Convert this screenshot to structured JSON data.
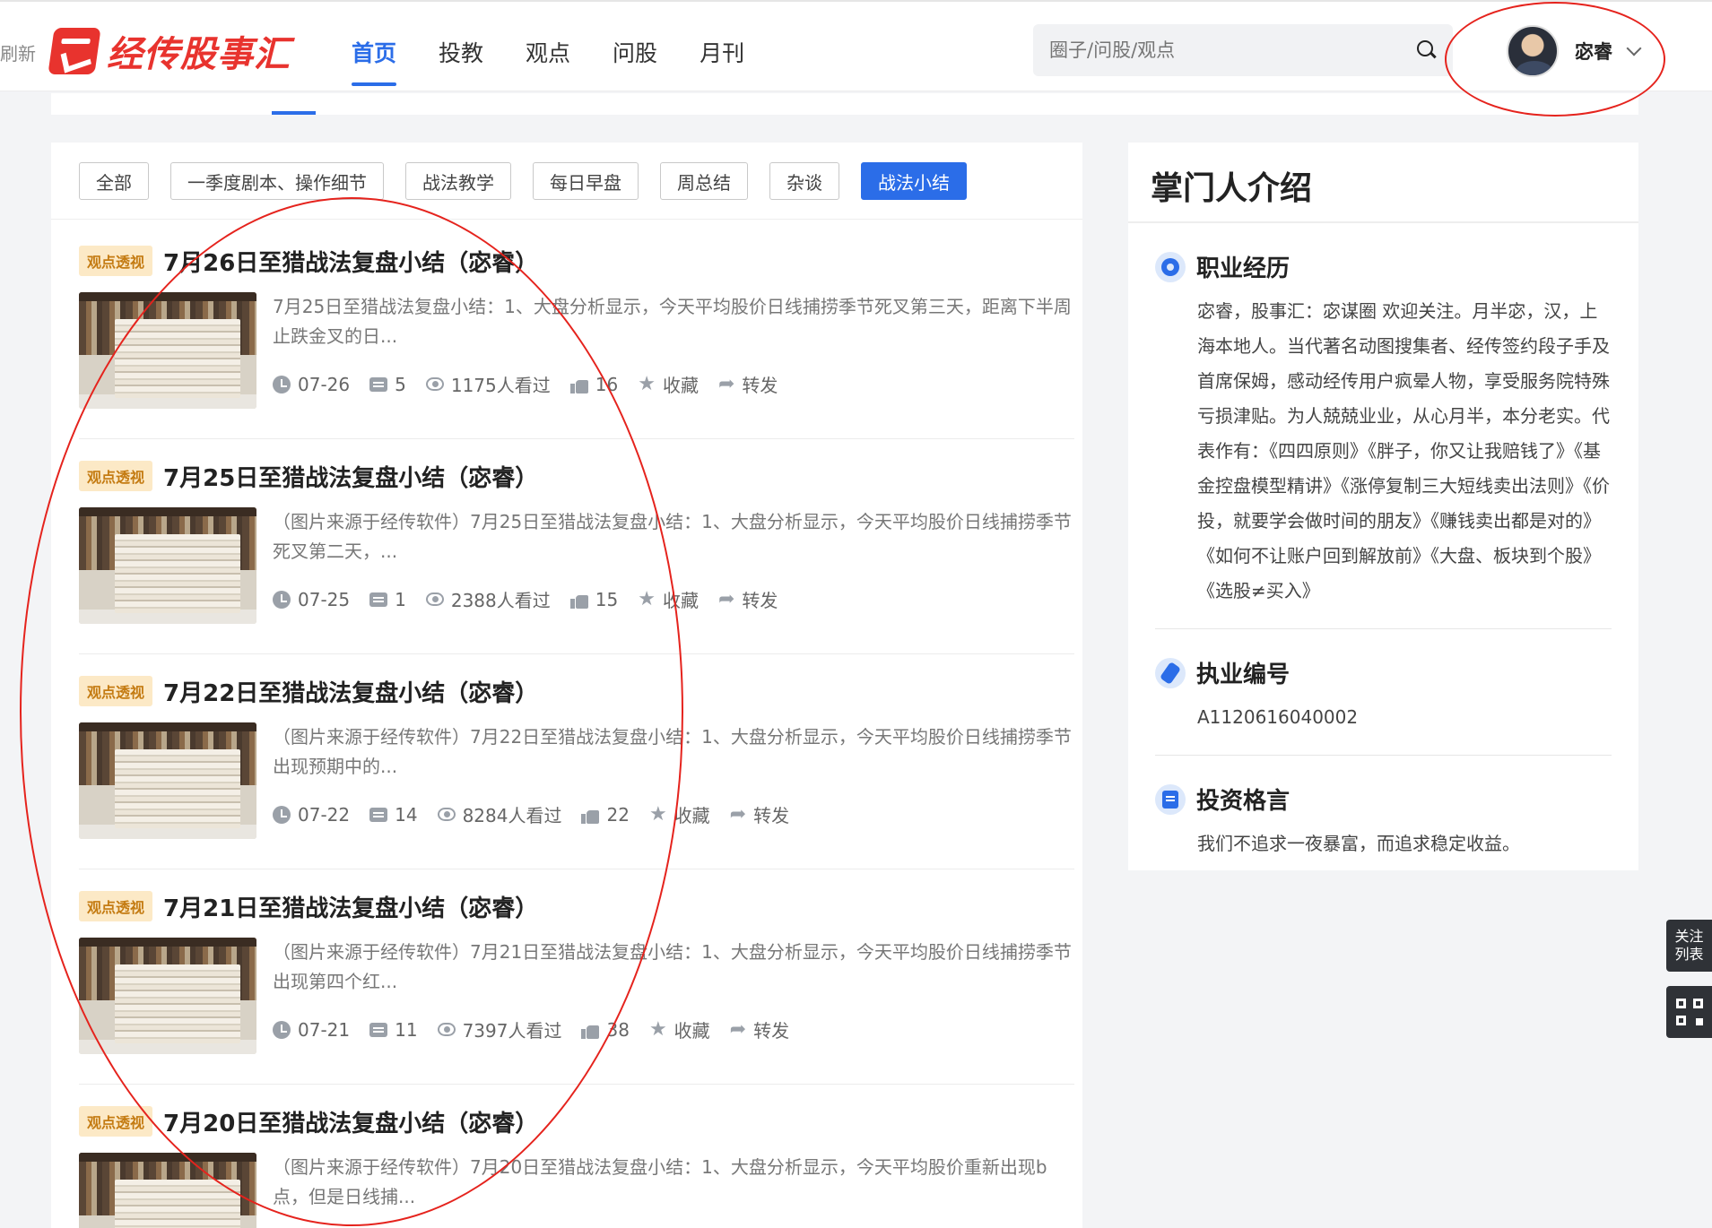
{
  "header": {
    "refresh_label": "刷新",
    "logo_text": "经传股事汇",
    "nav": [
      "首页",
      "投教",
      "观点",
      "问股",
      "月刊"
    ],
    "active_nav": "首页",
    "search_placeholder": "圈子/问股/观点",
    "user_name": "宓睿"
  },
  "filters": {
    "chips": [
      "全部",
      "一季度剧本、操作细节",
      "战法教学",
      "每日早盘",
      "周总结",
      "杂谈",
      "战法小结"
    ],
    "active": "战法小结"
  },
  "articles": [
    {
      "tag": "观点透视",
      "title": "7月26日至猎战法复盘小结（宓睿）",
      "summary": "7月25日至猎战法复盘小结：1、大盘分析显示，今天平均股价日线捕捞季节死叉第三天，距离下半周止跌金叉的日...",
      "date": "07-26",
      "comments": "5",
      "views": "1175人看过",
      "likes": "16",
      "favorite": "收藏",
      "share": "转发"
    },
    {
      "tag": "观点透视",
      "title": "7月25日至猎战法复盘小结（宓睿）",
      "summary": "（图片来源于经传软件）7月25日至猎战法复盘小结：1、大盘分析显示，今天平均股价日线捕捞季节死叉第二天，...",
      "date": "07-25",
      "comments": "1",
      "views": "2388人看过",
      "likes": "15",
      "favorite": "收藏",
      "share": "转发"
    },
    {
      "tag": "观点透视",
      "title": "7月22日至猎战法复盘小结（宓睿）",
      "summary": "（图片来源于经传软件）7月22日至猎战法复盘小结：1、大盘分析显示，今天平均股价日线捕捞季节出现预期中的...",
      "date": "07-22",
      "comments": "14",
      "views": "8284人看过",
      "likes": "22",
      "favorite": "收藏",
      "share": "转发"
    },
    {
      "tag": "观点透视",
      "title": "7月21日至猎战法复盘小结（宓睿）",
      "summary": "（图片来源于经传软件）7月21日至猎战法复盘小结：1、大盘分析显示，今天平均股价日线捕捞季节出现第四个红...",
      "date": "07-21",
      "comments": "11",
      "views": "7397人看过",
      "likes": "38",
      "favorite": "收藏",
      "share": "转发"
    },
    {
      "tag": "观点透视",
      "title": "7月20日至猎战法复盘小结（宓睿）",
      "summary": "（图片来源于经传软件）7月20日至猎战法复盘小结：1、大盘分析显示，今天平均股价重新出现b点，但是日线捕...",
      "date": "",
      "comments": "",
      "views": "",
      "likes": "",
      "favorite": "",
      "share": ""
    }
  ],
  "sidebar": {
    "title": "掌门人介绍",
    "career_title": "职业经历",
    "career_text": "宓睿，股事汇：宓谋圈 欢迎关注。月半宓，汉，上海本地人。当代著名动图搜集者、经传签约段子手及首席保姆，感动经传用户疯晕人物，享受服务院特殊亏损津贴。为人兢兢业业，从心月半，本分老实。代表作有：《四四原则》《胖子，你又让我赔钱了》《基金控盘模型精讲》《涨停复制三大短线卖出法则》《价投，就要学会做时间的朋友》《赚钱卖出都是对的》《如何不让账户回到解放前》《大盘、板块到个股》《选股≠买入》",
    "license_title": "执业编号",
    "license_no": "A1120616040002",
    "motto_title": "投资格言",
    "motto_text": "我们不追求一夜暴富，而追求稳定收益。"
  },
  "float": {
    "follow_label": "关注列表"
  },
  "colors": {
    "accent": "#2b6de8",
    "brand_red": "#e8332e",
    "annotation_red": "#e5231d",
    "tag_bg": "#fce9c6",
    "tag_text": "#c47b12"
  }
}
